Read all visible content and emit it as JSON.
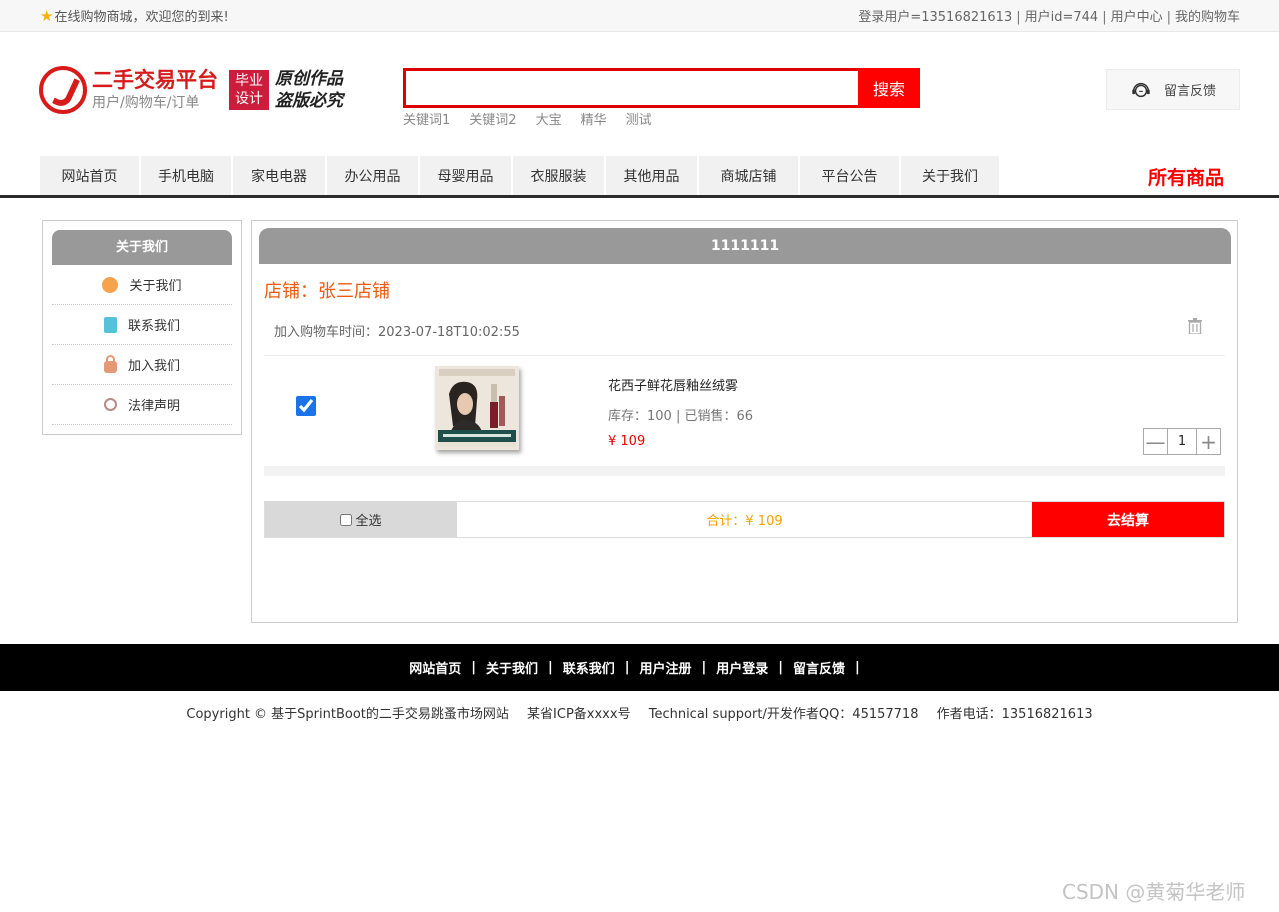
{
  "topbar": {
    "welcome": "在线购物商城，欢迎您的到来!",
    "user_info": "登录用户=13516821613",
    "user_id": "用户id=744",
    "user_center": "用户中心",
    "my_cart": "我的购物车"
  },
  "logo": {
    "title": "二手交易平台",
    "subtitle": "用户/购物车/订单",
    "badge_line1": "毕业",
    "badge_line2": "设计",
    "slogan_line1": "原创作品",
    "slogan_line2": "盗版必究"
  },
  "search": {
    "value": "",
    "button": "搜索",
    "hotwords": [
      "关键词1",
      "关键词2",
      "大宝",
      "精华",
      "测试"
    ]
  },
  "feedback": {
    "label": "留言反馈",
    "icon": "headset-icon"
  },
  "nav": {
    "items": [
      "网站首页",
      "手机电脑",
      "家电电器",
      "办公用品",
      "母婴用品",
      "衣服服装",
      "其他用品",
      "商城店铺",
      "平台公告",
      "关于我们"
    ],
    "all_goods": "所有商品"
  },
  "sidebar": {
    "title": "关于我们",
    "items": [
      {
        "label": "关于我们",
        "icon": "about-icon"
      },
      {
        "label": "联系我们",
        "icon": "contact-icon"
      },
      {
        "label": "加入我们",
        "icon": "lock-icon"
      },
      {
        "label": "法律声明",
        "icon": "power-icon"
      }
    ]
  },
  "cart": {
    "header": "1111111",
    "shop": "店铺：张三店铺",
    "added_time": "加入购物车时间：2023-07-18T10:02:55",
    "product": {
      "name": "花西子鲜花唇釉丝绒雾",
      "stock": "库存：100 | 已销售：66",
      "price": "¥ 109",
      "quantity": "1",
      "checked": true
    },
    "select_all": "全选",
    "total": "合计：¥ 109",
    "checkout": "去结算"
  },
  "footer": {
    "links": [
      "网站首页",
      "关于我们",
      "联系我们",
      "用户注册",
      "用户登录",
      "留言反馈"
    ],
    "separator": "|",
    "copyright": "Copyright © 基于SprintBoot的二手交易跳蚤市场网站",
    "icp": "某省ICP备xxxx号",
    "support": "Technical support/开发作者QQ：45157718",
    "phone": "作者电话：13516821613"
  },
  "watermark": "CSDN @黄菊华老师",
  "colors": {
    "accent_red": "#ff0000",
    "shop_orange": "#f05a10",
    "total_orange": "#f5a000",
    "header_gray": "#999999"
  }
}
